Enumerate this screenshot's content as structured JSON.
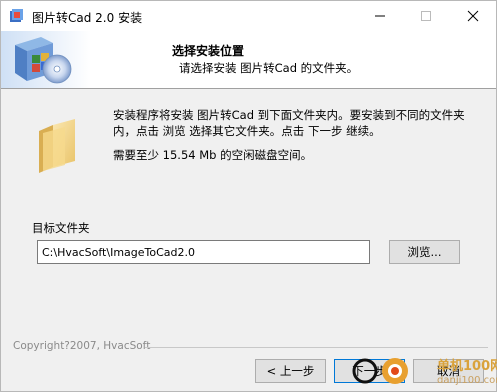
{
  "titlebar": {
    "title": "图片转Cad 2.0 安装",
    "minimize": "—",
    "maximize": "☐",
    "close": "✕"
  },
  "header": {
    "title": "选择安装位置",
    "subtitle": "请选择安装 图片转Cad 的文件夹。"
  },
  "body": {
    "description": "安装程序将安装 图片转Cad 到下面文件夹内。要安装到不同的文件夹内，点击 浏览 选择其它文件夹。点击 下一步 继续。",
    "space_required": "需要至少 15.54 Mb 的空闲磁盘空间。",
    "group_label": "目标文件夹",
    "install_path": "C:\\HvacSoft\\ImageToCad2.0",
    "browse_label": "浏览..."
  },
  "footer": {
    "copyright": "Copyright?2007, HvacSoft",
    "back_label": "< 上一步",
    "next_label": "下一步",
    "cancel_label": "取消"
  },
  "watermark": {
    "line1": "单机100网",
    "line2": "danji100.com"
  },
  "colors": {
    "focus_border": "#0078d7",
    "watermark_orange": "#e8a030"
  }
}
